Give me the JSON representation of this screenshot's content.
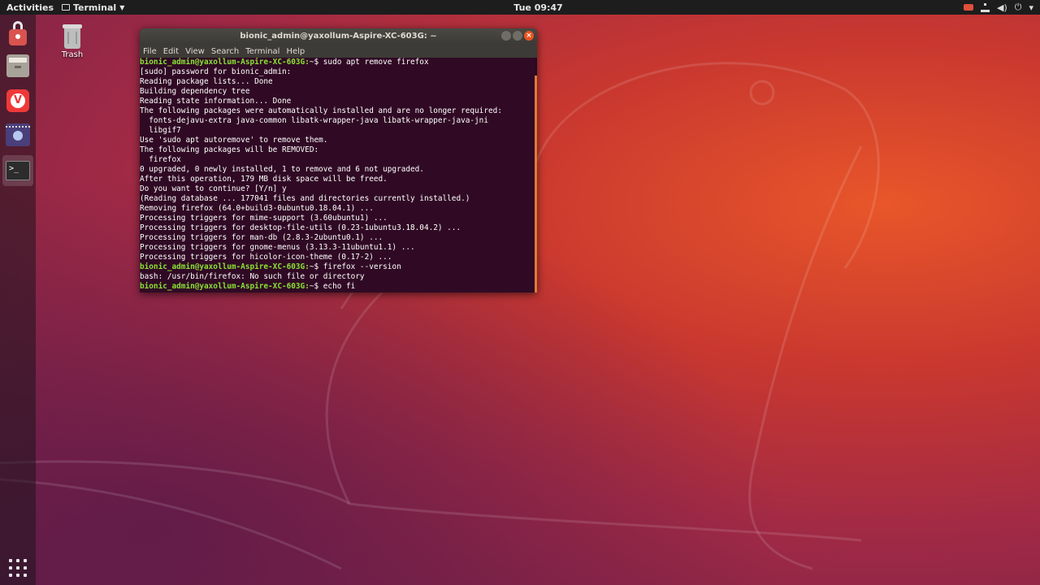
{
  "topbar": {
    "activities": "Activities",
    "app_menu": "Terminal",
    "clock": "Tue 09:47",
    "tray_icons": [
      "camera-indicator-icon",
      "network-icon",
      "volume-icon",
      "power-icon"
    ]
  },
  "dock": {
    "items": [
      {
        "name": "lock-app-icon"
      },
      {
        "name": "files-icon"
      },
      {
        "name": "vivaldi-browser-icon"
      },
      {
        "name": "video-editor-icon"
      },
      {
        "name": "terminal-icon",
        "active": true
      }
    ],
    "show_apps": "show-applications-icon"
  },
  "desktop": {
    "trash_label": "Trash"
  },
  "terminal": {
    "title": "bionic_admin@yaxollum-Aspire-XC-603G: ~",
    "menu": [
      "File",
      "Edit",
      "View",
      "Search",
      "Terminal",
      "Help"
    ],
    "lines": [
      {
        "prompt": "bionic_admin@yaxollum-Aspire-XC-603G:",
        "text": "~$ sudo apt remove firefox"
      },
      {
        "prompt": "",
        "text": "[sudo] password for bionic_admin:"
      },
      {
        "prompt": "",
        "text": "Reading package lists... Done"
      },
      {
        "prompt": "",
        "text": "Building dependency tree"
      },
      {
        "prompt": "",
        "text": "Reading state information... Done"
      },
      {
        "prompt": "",
        "text": "The following packages were automatically installed and are no longer required:"
      },
      {
        "prompt": "",
        "text": "  fonts-dejavu-extra java-common libatk-wrapper-java libatk-wrapper-java-jni"
      },
      {
        "prompt": "",
        "text": "  libgif7"
      },
      {
        "prompt": "",
        "text": "Use 'sudo apt autoremove' to remove them."
      },
      {
        "prompt": "",
        "text": "The following packages will be REMOVED:"
      },
      {
        "prompt": "",
        "text": "  firefox"
      },
      {
        "prompt": "",
        "text": "0 upgraded, 0 newly installed, 1 to remove and 6 not upgraded."
      },
      {
        "prompt": "",
        "text": "After this operation, 179 MB disk space will be freed."
      },
      {
        "prompt": "",
        "text": "Do you want to continue? [Y/n] y"
      },
      {
        "prompt": "",
        "text": "(Reading database ... 177041 files and directories currently installed.)"
      },
      {
        "prompt": "",
        "text": "Removing firefox (64.0+build3-0ubuntu0.18.04.1) ..."
      },
      {
        "prompt": "",
        "text": "Processing triggers for mime-support (3.60ubuntu1) ..."
      },
      {
        "prompt": "",
        "text": "Processing triggers for desktop-file-utils (0.23-1ubuntu3.18.04.2) ..."
      },
      {
        "prompt": "",
        "text": "Processing triggers for man-db (2.8.3-2ubuntu0.1) ..."
      },
      {
        "prompt": "",
        "text": "Processing triggers for gnome-menus (3.13.3-11ubuntu1.1) ..."
      },
      {
        "prompt": "",
        "text": "Processing triggers for hicolor-icon-theme (0.17-2) ..."
      },
      {
        "prompt": "bionic_admin@yaxollum-Aspire-XC-603G:",
        "text": "~$ firefox --version"
      },
      {
        "prompt": "",
        "text": "bash: /usr/bin/firefox: No such file or directory"
      },
      {
        "prompt": "bionic_admin@yaxollum-Aspire-XC-603G:",
        "text": "~$ echo fi"
      }
    ]
  },
  "colors": {
    "terminal_bg": "#300a24",
    "prompt": "#8ae234",
    "accent": "#e95420"
  }
}
